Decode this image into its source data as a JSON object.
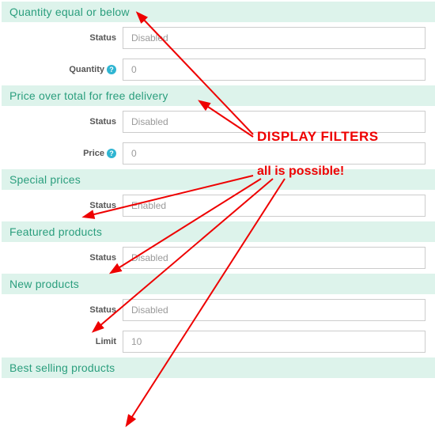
{
  "annotations": {
    "title": "DISPLAY FILTERS",
    "subtitle": "all is possible!"
  },
  "labels": {
    "status": "Status",
    "quantity": "Quantity",
    "price": "Price",
    "limit": "Limit"
  },
  "sections": {
    "qty_below": {
      "title": "Quantity equal or below",
      "status": "Disabled",
      "quantity": "0"
    },
    "price_over": {
      "title": "Price over total for free delivery",
      "status": "Disabled",
      "price": "0"
    },
    "special": {
      "title": "Special prices",
      "status": "Enabled"
    },
    "featured": {
      "title": "Featured products",
      "status": "Disabled"
    },
    "new": {
      "title": "New products",
      "status": "Disabled",
      "limit": "10"
    },
    "best": {
      "title": "Best selling products"
    }
  }
}
